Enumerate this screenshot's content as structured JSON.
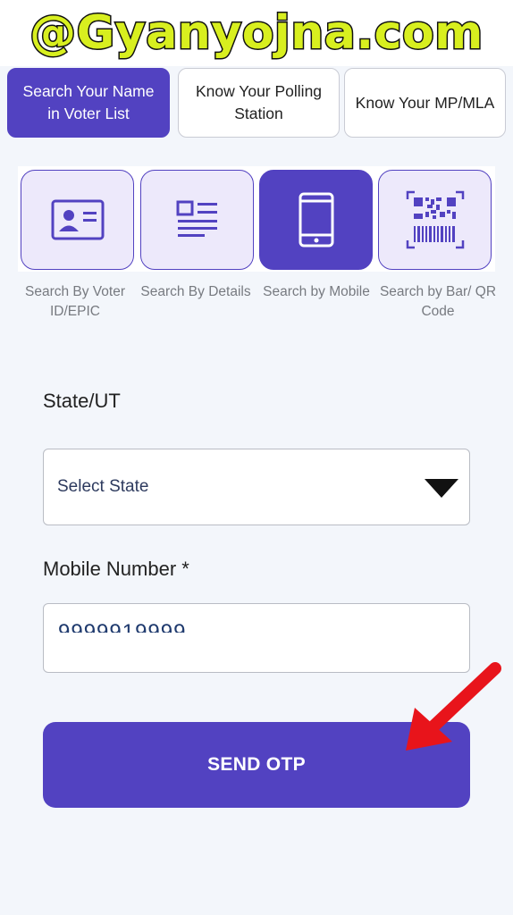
{
  "banner": {
    "text": "@Gyanyojna.com"
  },
  "tabs": [
    {
      "label": "Search Your Name in Voter List",
      "active": true
    },
    {
      "label": "Know Your Polling Station",
      "active": false
    },
    {
      "label": "Know Your MP/MLA",
      "active": false
    }
  ],
  "search_methods": [
    {
      "label": "Search By Voter ID/EPIC",
      "icon": "id-card-icon",
      "active": false
    },
    {
      "label": "Search By Details",
      "icon": "details-list-icon",
      "active": false
    },
    {
      "label": "Search by Mobile",
      "icon": "mobile-phone-icon",
      "active": true
    },
    {
      "label": "Search by Bar/ QR Code",
      "icon": "qr-barcode-icon",
      "active": false
    }
  ],
  "form": {
    "state_label": "State/UT",
    "state_placeholder": "Select State",
    "mobile_label": "Mobile Number *",
    "mobile_value": "9999919999"
  },
  "send_button": {
    "label": "SEND OTP"
  },
  "colors": {
    "accent": "#5242c1",
    "card_bg": "#ede9fb",
    "banner_text": "#d8ef1f",
    "arrow": "#e8141b"
  }
}
